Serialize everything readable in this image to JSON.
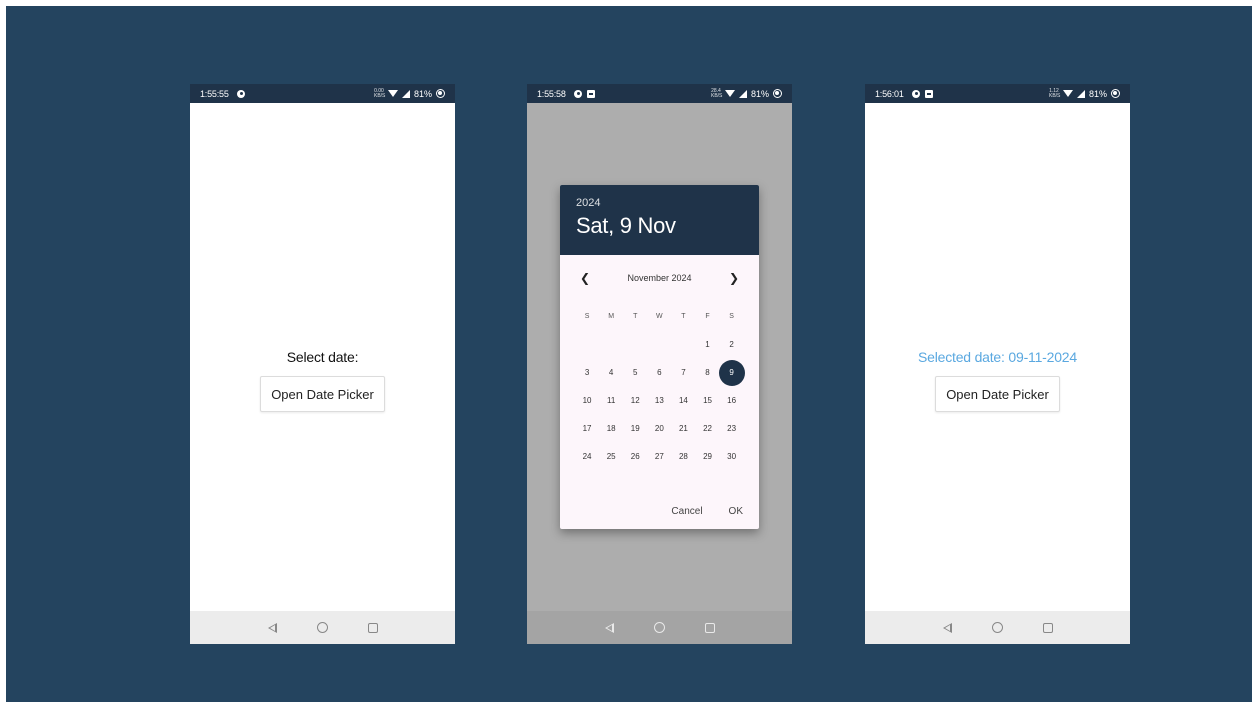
{
  "screens": [
    {
      "time": "1:55:55",
      "status_tiny": "0.00 KB/S",
      "battery": "81%",
      "label": "Select date:",
      "button": "Open Date Picker"
    },
    {
      "time": "1:55:58",
      "status_tiny": "28.4 KB/S",
      "battery": "81%",
      "dialog": {
        "year": "2024",
        "date_heading": "Sat, 9 Nov",
        "month_label": "November 2024",
        "weekdays": [
          "S",
          "M",
          "T",
          "W",
          "T",
          "F",
          "S"
        ],
        "weeks": [
          [
            "",
            "",
            "",
            "",
            "",
            "1",
            "2"
          ],
          [
            "3",
            "4",
            "5",
            "6",
            "7",
            "8",
            "9"
          ],
          [
            "10",
            "11",
            "12",
            "13",
            "14",
            "15",
            "16"
          ],
          [
            "17",
            "18",
            "19",
            "20",
            "21",
            "22",
            "23"
          ],
          [
            "24",
            "25",
            "26",
            "27",
            "28",
            "29",
            "30"
          ]
        ],
        "selected_day": "9",
        "cancel": "Cancel",
        "ok": "OK"
      }
    },
    {
      "time": "1:56:01",
      "status_tiny": "1.12 KB/S",
      "battery": "81%",
      "label": "Selected date: 09-11-2024",
      "button": "Open Date Picker"
    }
  ],
  "colors": {
    "background": "#24445f",
    "status_bar": "#1f3349",
    "accent_selected_text": "#5aa8e0",
    "dialog_header": "#1f3349"
  },
  "icons": [
    "back-icon",
    "home-icon",
    "recents-icon",
    "wifi-icon",
    "signal-icon",
    "battery-icon"
  ]
}
